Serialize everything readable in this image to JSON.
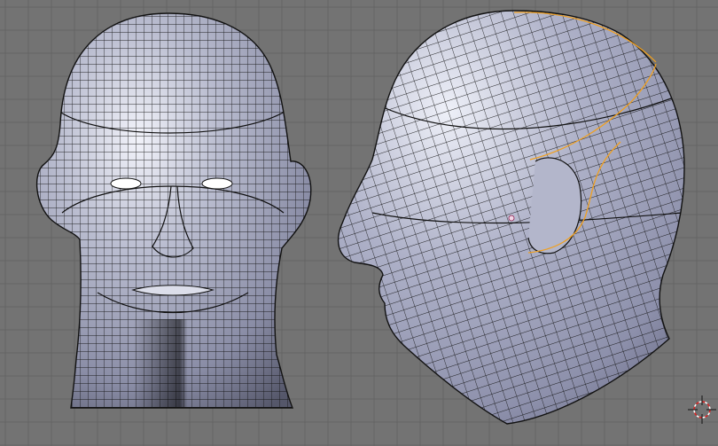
{
  "viewport": {
    "background_color": "#737373",
    "grid_color": "#656565",
    "mesh_surface_color": "#a8abc2",
    "mesh_wire_color": "#111111",
    "selection_color": "#f0a020",
    "cursor_color": "#e02020",
    "views": [
      {
        "name": "front-view",
        "object": "head-mesh"
      },
      {
        "name": "side-view",
        "object": "head-mesh"
      }
    ],
    "cursor_icon": "3d-cursor-icon"
  }
}
